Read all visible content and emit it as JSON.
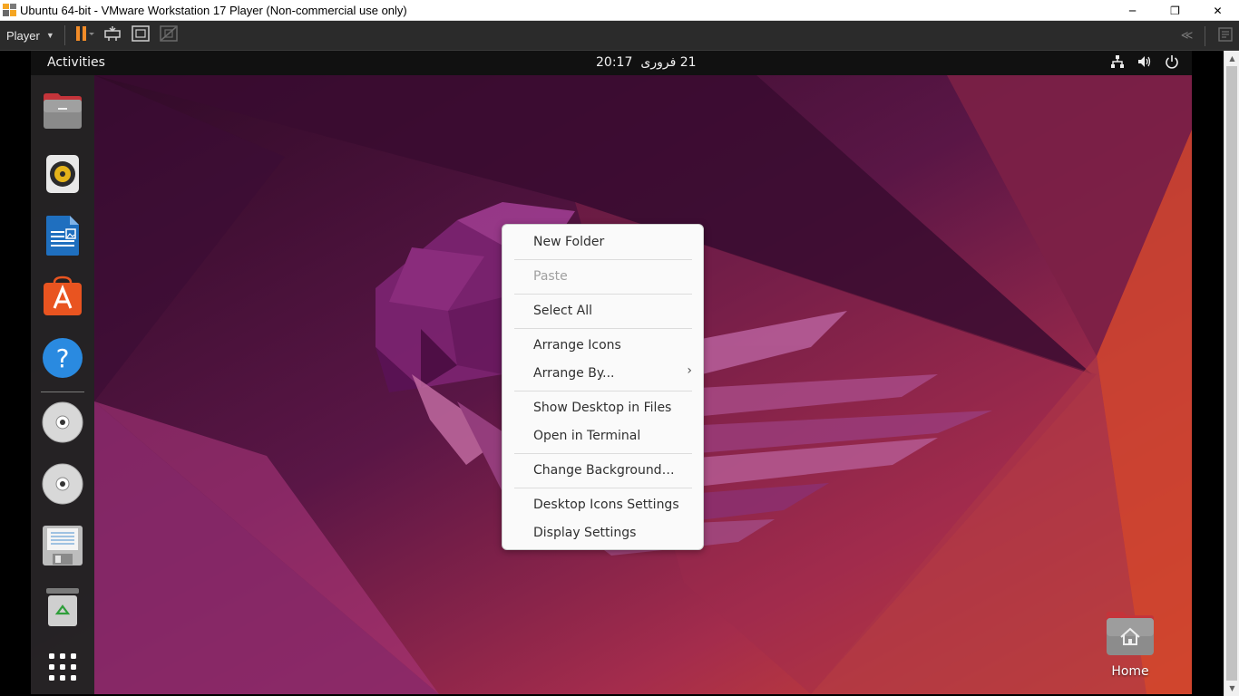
{
  "vmware": {
    "window_title": "Ubuntu 64-bit - VMware Workstation 17 Player (Non-commercial use only)",
    "player_menu_label": "Player",
    "window_controls": {
      "minimize": "─",
      "restore": "❐",
      "close": "✕"
    }
  },
  "ubuntu": {
    "topbar": {
      "activities_label": "Activities",
      "clock_time": "20:17",
      "clock_date": "21 فروری"
    },
    "dock": {
      "items": [
        {
          "name": "files-icon"
        },
        {
          "name": "rhythmbox-icon"
        },
        {
          "name": "libreoffice-writer-icon"
        },
        {
          "name": "ubuntu-software-icon"
        },
        {
          "name": "help-icon"
        },
        {
          "name": "dvd-drive-icon-1"
        },
        {
          "name": "dvd-drive-icon-2"
        },
        {
          "name": "floppy-icon"
        },
        {
          "name": "trash-icon"
        },
        {
          "name": "show-apps-icon"
        }
      ]
    },
    "context_menu": {
      "items": [
        {
          "label": "New Folder"
        },
        {
          "label": "Paste",
          "disabled": true
        },
        {
          "label": "Select All"
        },
        {
          "label": "Arrange Icons"
        },
        {
          "label": "Arrange By...",
          "submenu": true
        },
        {
          "label": "Show Desktop in Files"
        },
        {
          "label": "Open in Terminal"
        },
        {
          "label": "Change Background…"
        },
        {
          "label": "Desktop Icons Settings"
        },
        {
          "label": "Display Settings"
        }
      ]
    },
    "desktop_icons": {
      "home_label": "Home"
    }
  },
  "colors": {
    "accent": "#e95420",
    "wallpaper_dark": "#2c0c24",
    "wallpaper_mid": "#6e1d52",
    "wallpaper_light": "#c7384a"
  }
}
